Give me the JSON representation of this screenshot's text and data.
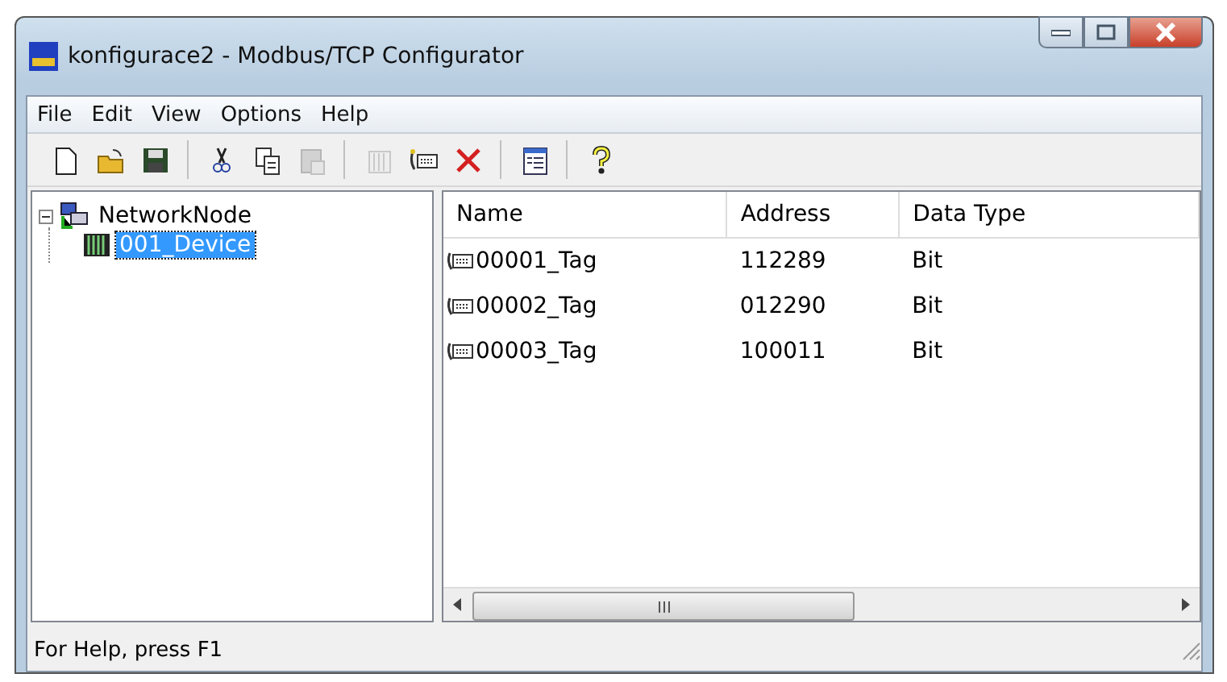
{
  "window": {
    "title": "konfigurace2 - Modbus/TCP Configurator"
  },
  "menu": [
    "File",
    "Edit",
    "View",
    "Options",
    "Help"
  ],
  "toolbar": [
    {
      "kind": "new",
      "disabled": false
    },
    {
      "kind": "open",
      "disabled": false
    },
    {
      "kind": "save",
      "disabled": false
    },
    {
      "kind": "sep"
    },
    {
      "kind": "cut",
      "disabled": false
    },
    {
      "kind": "copy",
      "disabled": false
    },
    {
      "kind": "paste",
      "disabled": true
    },
    {
      "kind": "sep"
    },
    {
      "kind": "device",
      "disabled": true
    },
    {
      "kind": "tag",
      "disabled": false
    },
    {
      "kind": "delete",
      "disabled": false
    },
    {
      "kind": "sep"
    },
    {
      "kind": "properties",
      "disabled": false
    },
    {
      "kind": "sep"
    },
    {
      "kind": "help",
      "disabled": false
    }
  ],
  "tree": [
    {
      "label": "NetworkNode",
      "kind": "network",
      "expanded": true,
      "selected": false,
      "children": [
        {
          "label": "001_Device",
          "kind": "device",
          "selected": true
        }
      ]
    }
  ],
  "table": {
    "columns": [
      "Name",
      "Address",
      "Data Type"
    ],
    "rows": [
      {
        "name": "00001_Tag",
        "address": "112289",
        "data_type": "Bit"
      },
      {
        "name": "00002_Tag",
        "address": "012290",
        "data_type": "Bit"
      },
      {
        "name": "00003_Tag",
        "address": "100011",
        "data_type": "Bit"
      }
    ]
  },
  "status_bar": "For Help, press F1"
}
